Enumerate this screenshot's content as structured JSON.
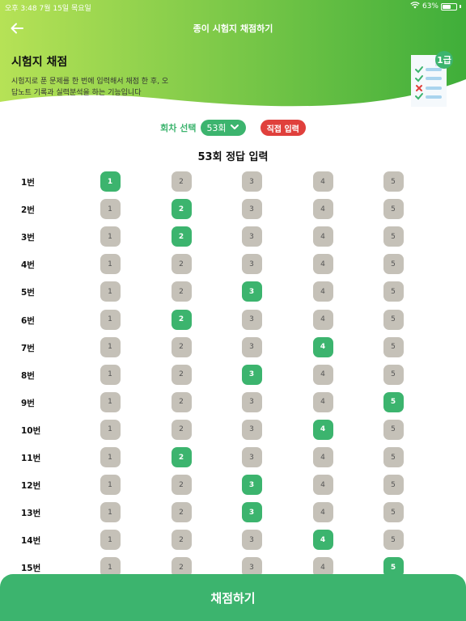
{
  "status": {
    "time_date": "오후 3:48   7월 15일 목요일",
    "battery": "63%",
    "battery_fraction": 0.63
  },
  "nav": {
    "title": "종이 시험지 채점하기",
    "back_icon": "arrow-left-icon"
  },
  "intro": {
    "title": "시험지 채점",
    "description": "시험지로 푼 문제를 한 번에 입력해서 채점 한 후, 오답노트 기록과 실력분석을 하는 기능입니다"
  },
  "badge": {
    "label": "1급",
    "icon": "checklist-document-icon"
  },
  "selector": {
    "label": "회차 선택",
    "selected": "53회",
    "direct_input": "직접 입력"
  },
  "section_title": "53회 정답 입력",
  "options": [
    "1",
    "2",
    "3",
    "4",
    "5"
  ],
  "questions": [
    {
      "label": "1번",
      "selected": 1
    },
    {
      "label": "2번",
      "selected": 2
    },
    {
      "label": "3번",
      "selected": 2
    },
    {
      "label": "4번",
      "selected": null
    },
    {
      "label": "5번",
      "selected": 3
    },
    {
      "label": "6번",
      "selected": 2
    },
    {
      "label": "7번",
      "selected": 4
    },
    {
      "label": "8번",
      "selected": 3
    },
    {
      "label": "9번",
      "selected": 5
    },
    {
      "label": "10번",
      "selected": 4
    },
    {
      "label": "11번",
      "selected": 2
    },
    {
      "label": "12번",
      "selected": 3
    },
    {
      "label": "13번",
      "selected": 3
    },
    {
      "label": "14번",
      "selected": 4
    },
    {
      "label": "15번",
      "selected": 5
    }
  ],
  "grade_button": "채점하기",
  "colors": {
    "accent": "#3cb46e",
    "header_gradient_start": "#b6e256",
    "header_gradient_end": "#3fae3a",
    "unselected": "#c5c1b8",
    "danger": "#e0403c"
  }
}
